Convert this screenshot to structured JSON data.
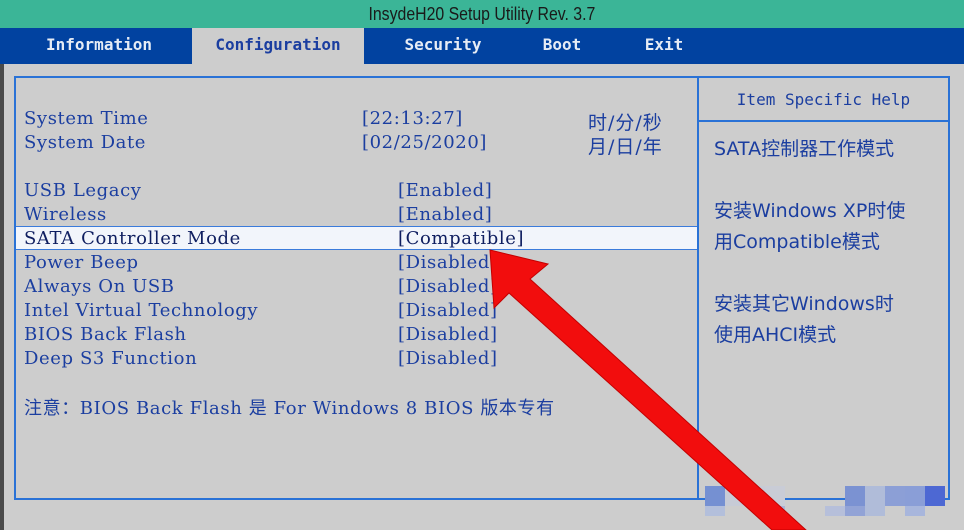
{
  "window": {
    "title": "InsydeH20 Setup Utility Rev. 3.7"
  },
  "menu": {
    "tabs": [
      {
        "label": "Information",
        "active": false
      },
      {
        "label": "Configuration",
        "active": true
      },
      {
        "label": "Security",
        "active": false
      },
      {
        "label": "Boot",
        "active": false
      },
      {
        "label": "Exit",
        "active": false
      }
    ]
  },
  "settings": {
    "system_time": {
      "label": "System Time",
      "value": "[22:13:27]",
      "unit": "时/分/秒"
    },
    "system_date": {
      "label": "System Date",
      "value": "[02/25/2020]",
      "unit": "月/日/年"
    },
    "items": [
      {
        "label": "USB Legacy",
        "value": "[Enabled]",
        "selected": false
      },
      {
        "label": "Wireless",
        "value": "[Enabled]",
        "selected": false
      },
      {
        "label": "SATA Controller Mode",
        "value": "[Compatible]",
        "selected": true
      },
      {
        "label": "Power Beep",
        "value": "[Disabled]",
        "selected": false
      },
      {
        "label": "Always On USB",
        "value": "[Disabled]",
        "selected": false
      },
      {
        "label": "Intel Virtual Technology",
        "value": "[Disabled]",
        "selected": false
      },
      {
        "label": "BIOS Back Flash",
        "value": "[Disabled]",
        "selected": false
      },
      {
        "label": "Deep S3 Function",
        "value": "[Disabled]",
        "selected": false
      }
    ],
    "note": "注意：BIOS Back Flash 是 For Windows 8 BIOS 版本专有"
  },
  "help": {
    "title": "Item Specific Help",
    "lines": [
      "SATA控制器工作模式",
      "安装Windows  XP时使",
      "用Compatible模式",
      "安装其它Windows时",
      "使用AHCI模式"
    ]
  },
  "annotation": {
    "arrow_color": "#ff0000",
    "target": "SATA Controller Mode value"
  },
  "colors": {
    "title_bar": "#3bb597",
    "menu_bar": "#0142a0",
    "text_blue": "#1b3ea0",
    "panel_bg": "#cdcdcd",
    "border": "#2a72d6"
  }
}
